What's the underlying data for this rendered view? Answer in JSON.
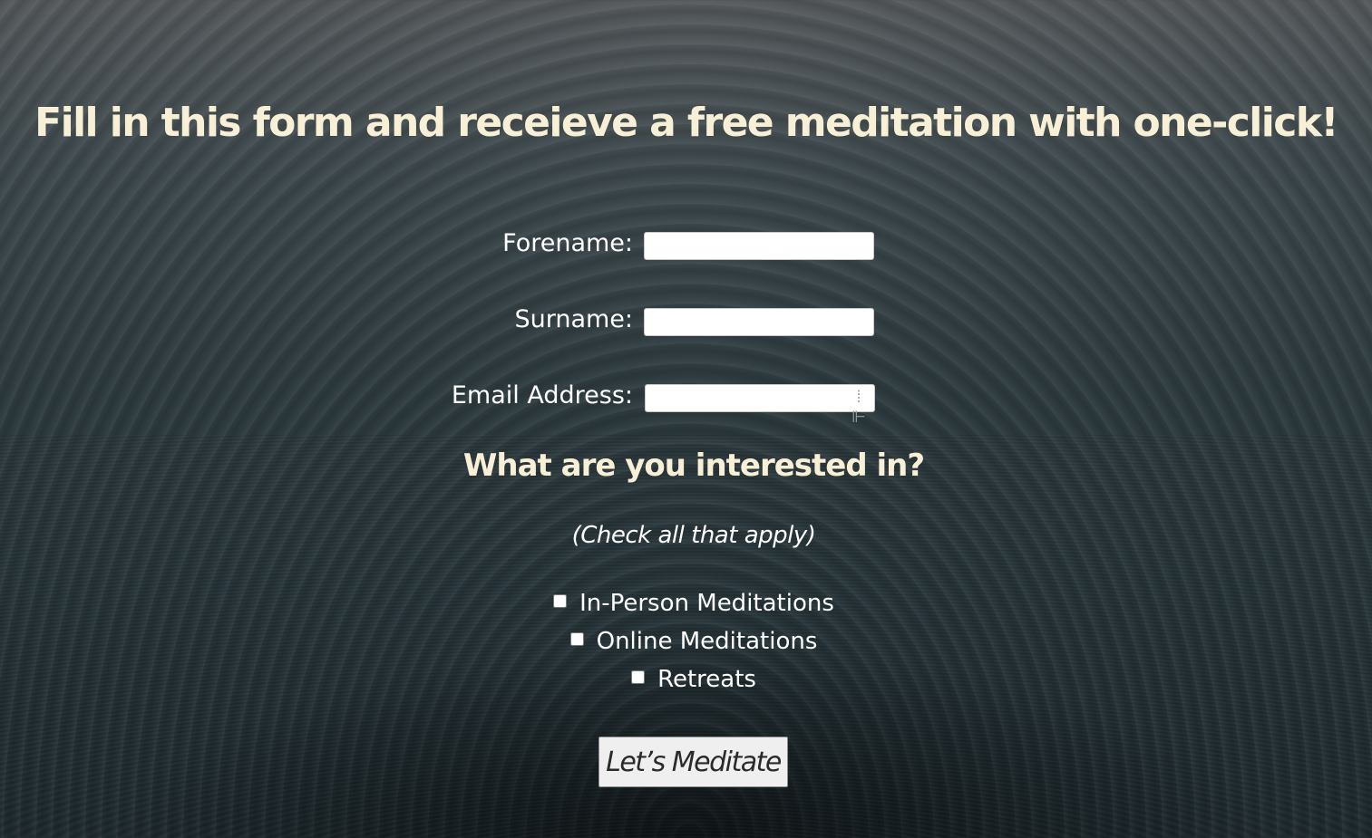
{
  "page": {
    "headline": "Fill in this form and receieve a free meditation with one-click!"
  },
  "form": {
    "fields": [
      {
        "label": "Forename:",
        "value": "",
        "placeholder": ""
      },
      {
        "label": "Surname:",
        "value": "",
        "placeholder": ""
      },
      {
        "label": "Email Address:",
        "value": "",
        "placeholder": "",
        "icon": "password-manager-key-icon"
      }
    ],
    "interests_title": "What are you interested in?",
    "interests_hint": "(Check all that apply)",
    "interests": [
      {
        "label": "In-Person Meditations",
        "checked": false
      },
      {
        "label": "Online Meditations",
        "checked": false
      },
      {
        "label": "Retreats",
        "checked": false
      }
    ],
    "submit_label": "Let’s Meditate"
  },
  "colors": {
    "headline": "#f7f0d6",
    "label": "#ffffff",
    "background_top": "#565a5d",
    "background_bottom": "#1f2b30",
    "button_bg": "#efefef"
  }
}
